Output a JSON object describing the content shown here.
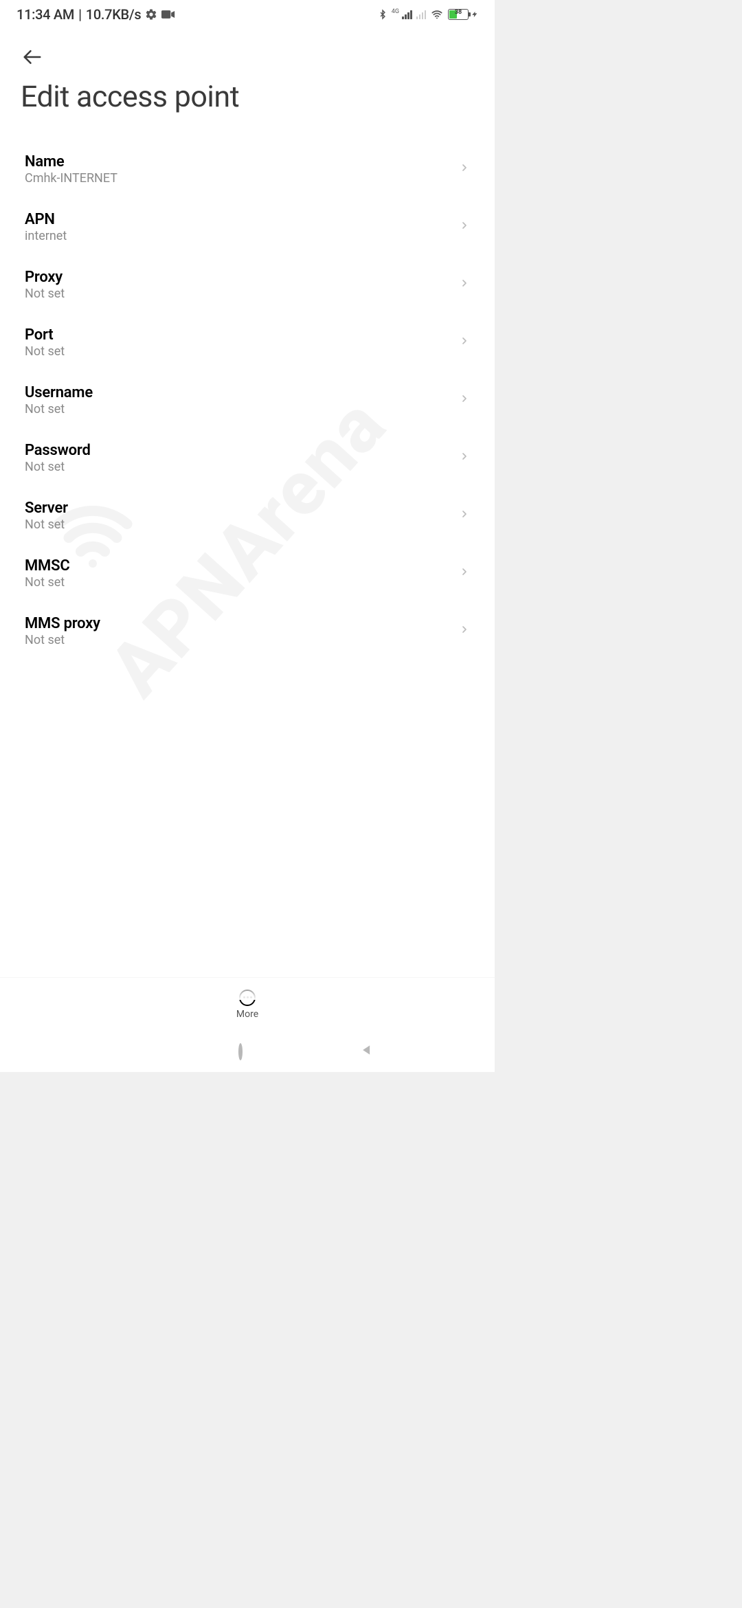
{
  "statusbar": {
    "time": "11:34 AM",
    "separator": "|",
    "net_speed": "10.7KB/s",
    "signal_label": "4G",
    "battery_percent": "38"
  },
  "header": {
    "title": "Edit access point"
  },
  "items": [
    {
      "label": "Name",
      "value": "Cmhk-INTERNET"
    },
    {
      "label": "APN",
      "value": "internet"
    },
    {
      "label": "Proxy",
      "value": "Not set"
    },
    {
      "label": "Port",
      "value": "Not set"
    },
    {
      "label": "Username",
      "value": "Not set"
    },
    {
      "label": "Password",
      "value": "Not set"
    },
    {
      "label": "Server",
      "value": "Not set"
    },
    {
      "label": "MMSC",
      "value": "Not set"
    },
    {
      "label": "MMS proxy",
      "value": "Not set"
    }
  ],
  "bottom": {
    "more_label": "More"
  },
  "watermark": "APNArena"
}
